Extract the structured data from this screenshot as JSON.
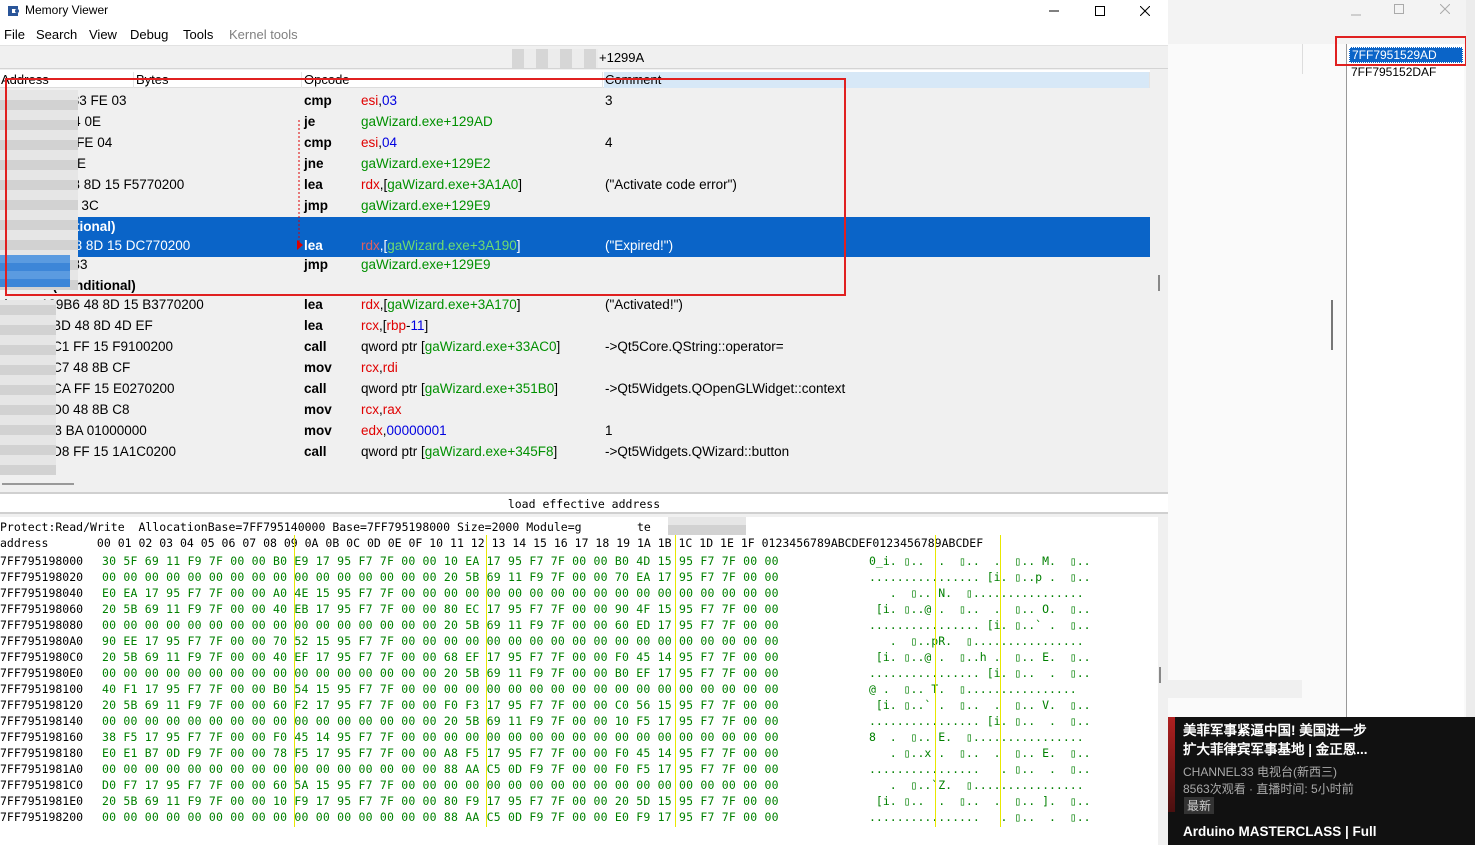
{
  "window": {
    "title": "Memory Viewer"
  },
  "menu": [
    "File",
    "Search",
    "View",
    "Debug",
    "Tools",
    "Kernel tools"
  ],
  "address_bar": {
    "value": "+1299A"
  },
  "disasm": {
    "headers": [
      "Address",
      "Bytes",
      "Opcode",
      "Comment"
    ],
    "rows": [
      {
        "type": "code",
        "addr": "exe+1299A 83 FE 03",
        "mnem": "cmp",
        "op": [
          [
            "reg",
            "esi"
          ],
          [
            "",
            ","
          ],
          [
            "num",
            "03"
          ]
        ],
        "comment": "3"
      },
      {
        "type": "code",
        "addr": "xe+1299D 74 0E",
        "mnem": "je",
        "op": [
          [
            "sym",
            "gaWizard.exe+129AD"
          ]
        ],
        "comment": ""
      },
      {
        "type": "code",
        "addr": "e+1299F 83 FE 04",
        "mnem": "cmp",
        "op": [
          [
            "reg",
            "esi"
          ],
          [
            "",
            ","
          ],
          [
            "num",
            "04"
          ]
        ],
        "comment": "4"
      },
      {
        "type": "code",
        "addr": "+129A2 75 3E",
        "mnem": "jne",
        "op": [
          [
            "sym",
            "gaWizard.exe+129E2"
          ]
        ],
        "comment": ""
      },
      {
        "type": "code",
        "addr": "xe+129A4 48 8D 15 F5770200",
        "mnem": "lea",
        "op": [
          [
            "reg",
            "rdx"
          ],
          [
            "",
            ",["
          ],
          [
            "sym",
            "gaWizard.exe+3A1A0"
          ],
          [
            "",
            "]"
          ]
        ],
        "comment": "(\"Activate code error\")"
      },
      {
        "type": "code",
        "addr": "e+129AB EB 3C",
        "mnem": "jmp",
        "op": [
          [
            "sym",
            "gaWizard.exe+129E9"
          ]
        ],
        "comment": ""
      },
      {
        "type": "label",
        "text": "299D(Conditional)",
        "sel": true
      },
      {
        "type": "code",
        "addr": "ce+129AD 48 8D 15 DC770200",
        "mnem": "lea",
        "op": [
          [
            "reg",
            "rdx"
          ],
          [
            "",
            ",["
          ],
          [
            "sym",
            "gaWizard.exe+3A190"
          ],
          [
            "",
            "]"
          ]
        ],
        "comment": "(\"Expired!\")",
        "sel": true
      },
      {
        "type": "code",
        "addr": "+129B4 EB 33",
        "mnem": "jmp",
        "op": [
          [
            "sym",
            "gaWizard.exe+129E9"
          ]
        ],
        "comment": ""
      },
      {
        "type": "label",
        "text": "5152998(Conditional)"
      },
      {
        "type": "code",
        "addr": "d.exe+129B6 48 8D 15 B3770200",
        "mnem": "lea",
        "op": [
          [
            "reg",
            "rdx"
          ],
          [
            "",
            ",["
          ],
          [
            "sym",
            "gaWizard.exe+3A170"
          ],
          [
            "",
            "]"
          ]
        ],
        "comment": "(\"Activated!\")"
      },
      {
        "type": "code",
        "addr": "exe+129BD 48 8D 4D EF",
        "mnem": "lea",
        "op": [
          [
            "reg",
            "rcx"
          ],
          [
            "",
            ",["
          ],
          [
            "reg",
            "rbp"
          ],
          [
            "",
            "-"
          ],
          [
            "num",
            "11"
          ],
          [
            "",
            "]"
          ]
        ],
        "comment": ""
      },
      {
        "type": "code",
        "addr": "exe+129C1 FF 15 F9100200",
        "mnem": "call",
        "op": [
          [
            "",
            "qword ptr ["
          ],
          [
            "sym",
            "gaWizard.exe+33AC0"
          ],
          [
            "",
            "]"
          ]
        ],
        "comment": "->Qt5Core.QString::operator="
      },
      {
        "type": "code",
        "addr": "exe+129C7 48 8B CF",
        "mnem": "mov",
        "op": [
          [
            "reg",
            "rcx"
          ],
          [
            "",
            ","
          ],
          [
            "reg",
            "rdi"
          ]
        ],
        "comment": ""
      },
      {
        "type": "code",
        "addr": "exe+129CA FF 15 E0270200",
        "mnem": "call",
        "op": [
          [
            "",
            "qword ptr ["
          ],
          [
            "sym",
            "gaWizard.exe+351B0"
          ],
          [
            "",
            "]"
          ]
        ],
        "comment": "->Qt5Widgets.QOpenGLWidget::context"
      },
      {
        "type": "code",
        "addr": "exe+129D0 48 8B C8",
        "mnem": "mov",
        "op": [
          [
            "reg",
            "rcx"
          ],
          [
            "",
            ","
          ],
          [
            "reg",
            "rax"
          ]
        ],
        "comment": ""
      },
      {
        "type": "code",
        "addr": "xe+129D3 BA 01000000",
        "mnem": "mov",
        "op": [
          [
            "reg",
            "edx"
          ],
          [
            "",
            ","
          ],
          [
            "num",
            "00000001"
          ]
        ],
        "comment": "1"
      },
      {
        "type": "code",
        "addr": "exe+129D8 FF 15 1A1C0200",
        "mnem": "call",
        "op": [
          [
            "",
            "qword ptr ["
          ],
          [
            "sym",
            "gaWizard.exe+345F8"
          ],
          [
            "",
            "]"
          ]
        ],
        "comment": "->Qt5Widgets.QWizard::button"
      }
    ]
  },
  "description": "load effective address",
  "hex": {
    "info": "Protect:Read/Write  AllocationBase=7FF795140000 Base=7FF795198000 Size=2000 Module=g        te",
    "header": "address       00 01 02 03 04 05 06 07 08 09 0A 0B 0C 0D 0E 0F 10 11 12 13 14 15 16 17 18 19 1A 1B 1C 1D 1E 1F 0123456789ABCDEF0123456789ABCDEF",
    "rows": [
      {
        "a": "7FF795198000",
        "b": "30 5F 69 11 F9 7F 00 00 B0 E9 17 95 F7 7F 00 00 10 EA 17 95 F7 7F 00 00 B0 4D 15 95 F7 7F 00 00",
        "t": "0_i. ▯..  .  ▯..  .  ▯.. M.  ▯.."
      },
      {
        "a": "7FF795198020",
        "b": "00 00 00 00 00 00 00 00 00 00 00 00 00 00 00 00 20 5B 69 11 F9 7F 00 00 70 EA 17 95 F7 7F 00 00",
        "t": "................ [i. ▯..p .  ▯.."
      },
      {
        "a": "7FF795198040",
        "b": "E0 EA 17 95 F7 7F 00 00 A0 4E 15 95 F7 7F 00 00 00 00 00 00 00 00 00 00 00 00 00 00 00 00 00 00",
        "t": "   .  ▯.. N.  ▯................"
      },
      {
        "a": "7FF795198060",
        "b": "20 5B 69 11 F9 7F 00 00 40 EB 17 95 F7 7F 00 00 80 EC 17 95 F7 7F 00 00 90 4F 15 95 F7 7F 00 00",
        "t": " [i. ▯..@ .  ▯..  .  ▯.. O.  ▯.."
      },
      {
        "a": "7FF795198080",
        "b": "00 00 00 00 00 00 00 00 00 00 00 00 00 00 00 00 20 5B 69 11 F9 7F 00 00 60 ED 17 95 F7 7F 00 00",
        "t": "................ [i. ▯..` .  ▯.."
      },
      {
        "a": "7FF7951980A0",
        "b": "90 EE 17 95 F7 7F 00 00 70 52 15 95 F7 7F 00 00 00 00 00 00 00 00 00 00 00 00 00 00 00 00 00 00",
        "t": "   .  ▯..pR.  ▯................"
      },
      {
        "a": "7FF7951980C0",
        "b": "20 5B 69 11 F9 7F 00 00 40 EF 17 95 F7 7F 00 00 68 EF 17 95 F7 7F 00 00 F0 45 14 95 F7 7F 00 00",
        "t": " [i. ▯..@ .  ▯..h .  ▯.. E.  ▯.."
      },
      {
        "a": "7FF7951980E0",
        "b": "00 00 00 00 00 00 00 00 00 00 00 00 00 00 00 00 20 5B 69 11 F9 7F 00 00 B0 EF 17 95 F7 7F 00 00",
        "t": "................ [i. ▯..  .  ▯.."
      },
      {
        "a": "7FF795198100",
        "b": "40 F1 17 95 F7 7F 00 00 B0 54 15 95 F7 7F 00 00 00 00 00 00 00 00 00 00 00 00 00 00 00 00 00 00",
        "t": "@ .  ▯.. T.  ▯................"
      },
      {
        "a": "7FF795198120",
        "b": "20 5B 69 11 F9 7F 00 00 60 F2 17 95 F7 7F 00 00 F0 F3 17 95 F7 7F 00 00 C0 56 15 95 F7 7F 00 00",
        "t": " [i. ▯..` .  ▯..  .  ▯.. V.  ▯.."
      },
      {
        "a": "7FF795198140",
        "b": "00 00 00 00 00 00 00 00 00 00 00 00 00 00 00 00 20 5B 69 11 F9 7F 00 00 10 F5 17 95 F7 7F 00 00",
        "t": "................ [i. ▯..  .  ▯.."
      },
      {
        "a": "7FF795198160",
        "b": "38 F5 17 95 F7 7F 00 00 F0 45 14 95 F7 7F 00 00 00 00 00 00 00 00 00 00 00 00 00 00 00 00 00 00",
        "t": "8  .  ▯.. E.  ▯................"
      },
      {
        "a": "7FF795198180",
        "b": "E0 E1 B7 0D F9 7F 00 00 78 F5 17 95 F7 7F 00 00 A8 F5 17 95 F7 7F 00 00 F0 45 14 95 F7 7F 00 00",
        "t": "   . ▯..x .  ▯..  .  ▯.. E.  ▯.."
      },
      {
        "a": "7FF7951981A0",
        "b": "00 00 00 00 00 00 00 00 00 00 00 00 00 00 00 00 88 AA C5 0D F9 7F 00 00 F0 F5 17 95 F7 7F 00 00",
        "t": "................   . ▯..  .  ▯.."
      },
      {
        "a": "7FF7951981C0",
        "b": "D0 F7 17 95 F7 7F 00 00 60 5A 15 95 F7 7F 00 00 00 00 00 00 00 00 00 00 00 00 00 00 00 00 00 00",
        "t": "   .  ▯..`Z.  ▯................"
      },
      {
        "a": "7FF7951981E0",
        "b": "20 5B 69 11 F9 7F 00 00 10 F9 17 95 F7 7F 00 00 80 F9 17 95 F7 7F 00 00 20 5D 15 95 F7 7F 00 00",
        "t": " [i. ▯..  .  ▯..  .  ▯.. ].  ▯.."
      },
      {
        "a": "7FF795198200",
        "b": "00 00 00 00 00 00 00 00 00 00 00 00 00 00 00 00 88 AA C5 0D F9 7F 00 00 E0 F9 17 95 F7 7F 00 00",
        "t": "................   . ▯..  .  ▯.."
      }
    ]
  },
  "address_list": {
    "items": [
      "7FF7951529AD",
      "7FF795152DAF"
    ],
    "selected": 0
  },
  "video": {
    "title1": "美菲军事紧逼中国! 美国进一步",
    "title2": "扩大菲律宾军事基地 | 金正恩...",
    "channel": "CHANNEL33 电视台(新西三)",
    "stats": "8563次观看 · 直播时间: 5小时前",
    "badge": "最新",
    "next": "Arduino MASTERCLASS | Full"
  },
  "colors": {
    "selection": "#0a64c8",
    "register": "#e00000",
    "symbol": "#009000",
    "number": "#0000e0",
    "highlight_box": "#e02020"
  }
}
